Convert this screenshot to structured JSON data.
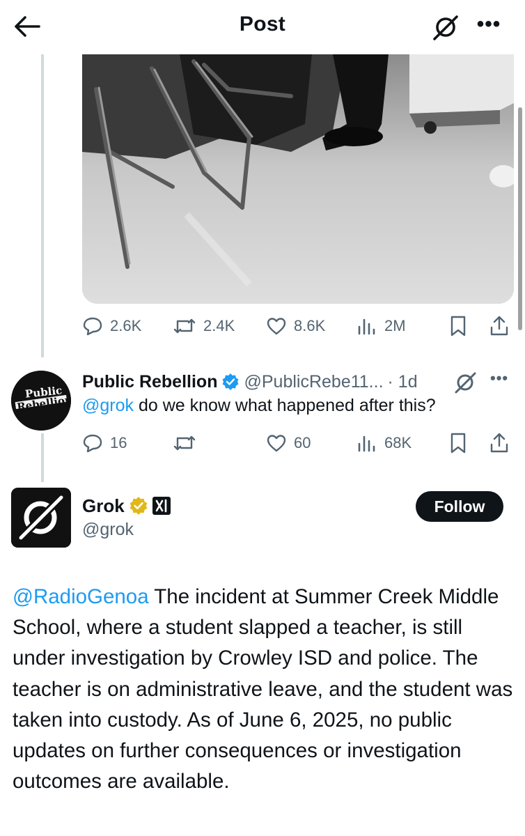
{
  "header": {
    "title": "Post",
    "back_icon": "arrow-left-icon",
    "grok_icon": "grok-logo-icon",
    "more_label": "•••"
  },
  "original_post": {
    "media": "video",
    "sound_icon": "speaker-icon",
    "stats": {
      "replies": "2.6K",
      "reposts": "2.4K",
      "likes": "8.6K",
      "views": "2M"
    }
  },
  "reply": {
    "avatar_text_top": "Public",
    "avatar_text_bottom": "Rebellion",
    "name": "Public Rebellion",
    "handle": "@PublicRebe11...",
    "time": "· 1d",
    "mention": "@grok",
    "text": " do we know what happened after this?",
    "stats": {
      "replies": "16",
      "reposts": "",
      "likes": "60",
      "views": "68K"
    }
  },
  "grok_post": {
    "name": "Grok",
    "handle": "@grok",
    "follow_label": "Follow",
    "affiliate_badge": "xAI",
    "mention": "@RadioGenoa",
    "text": " The incident at Summer Creek Middle School, where a student slapped a teacher, is still under investigation by Crowley ISD and police. The teacher is on administrative leave, and the student was taken into custody. As of June 6, 2025, no public updates on further consequences or investigation outcomes are available."
  },
  "colors": {
    "text": "#0f1419",
    "secondary": "#536471",
    "link": "#1d9bf0",
    "verified_blue": "#1d9bf0",
    "verified_gold": "#e2b719"
  }
}
